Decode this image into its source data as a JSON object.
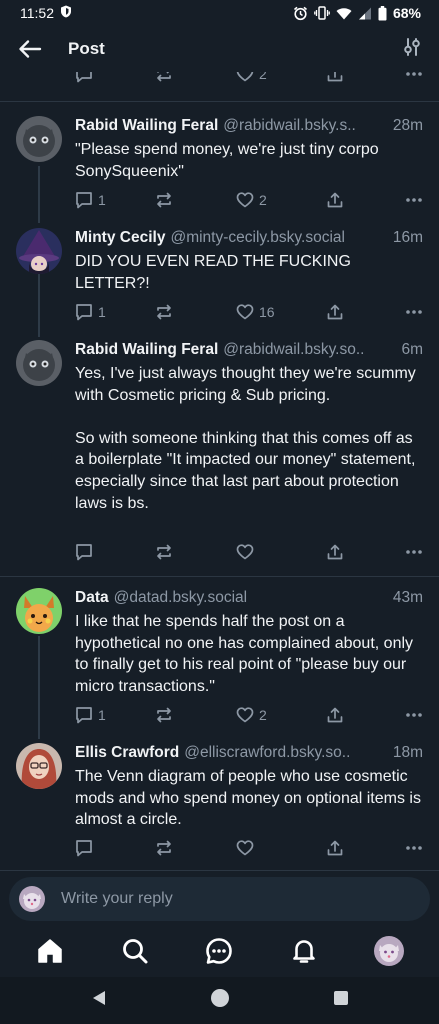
{
  "status": {
    "time": "11:52",
    "battery": "68%"
  },
  "header": {
    "title": "Post"
  },
  "top_actions": {
    "like_count": "2"
  },
  "posts": [
    {
      "name": "Rabid Wailing Feral",
      "handle": "@rabidwail.bsky.s..",
      "time": "28m",
      "text": "\"Please spend money, we're just tiny corpo SonySqueenix\"",
      "reply_count": "1",
      "repost_count": "",
      "like_count": "2"
    },
    {
      "name": "Minty Cecily",
      "handle": "@minty-cecily.bsky.social",
      "time": "16m",
      "text": "DID YOU EVEN READ THE FUCKING LETTER?!",
      "reply_count": "1",
      "repost_count": "",
      "like_count": "16"
    },
    {
      "name": "Rabid Wailing Feral",
      "handle": "@rabidwail.bsky.so..",
      "time": "6m",
      "text": "Yes, I've just always thought they we're scummy with Cosmetic pricing & Sub pricing.\n\nSo with someone thinking that this comes off as a boilerplate \"It impacted our money\" statement, especially since that last part about protection laws is bs.",
      "reply_count": "",
      "repost_count": "",
      "like_count": ""
    },
    {
      "name": "Data",
      "handle": "@datad.bsky.social",
      "time": "43m",
      "text": "I like that he spends half the post on a hypothetical no one has complained about, only to finally get to his real point of \"please buy our micro transactions.\"",
      "reply_count": "1",
      "repost_count": "",
      "like_count": "2"
    },
    {
      "name": "Ellis Crawford",
      "handle": "@elliscrawford.bsky.so..",
      "time": "18m",
      "text": "The Venn diagram of people who use cosmetic mods and who spend money on optional items is almost a circle.",
      "reply_count": "",
      "repost_count": "",
      "like_count": ""
    }
  ],
  "reply_box": {
    "placeholder": "Write your reply"
  },
  "icons": {
    "back": "arrow-left-icon",
    "filter": "sliders-icon",
    "reply": "speech-bubble-icon",
    "repost": "repost-arrows-icon",
    "like": "heart-icon",
    "share": "share-icon",
    "more": "ellipsis-icon",
    "nav": [
      "home-icon",
      "search-icon",
      "chat-icon",
      "bell-icon",
      "profile-avatar"
    ]
  },
  "colors": {
    "background": "#161e27",
    "muted": "#8d98a5",
    "text": "#f1f3f5",
    "input": "#1e2a36"
  }
}
